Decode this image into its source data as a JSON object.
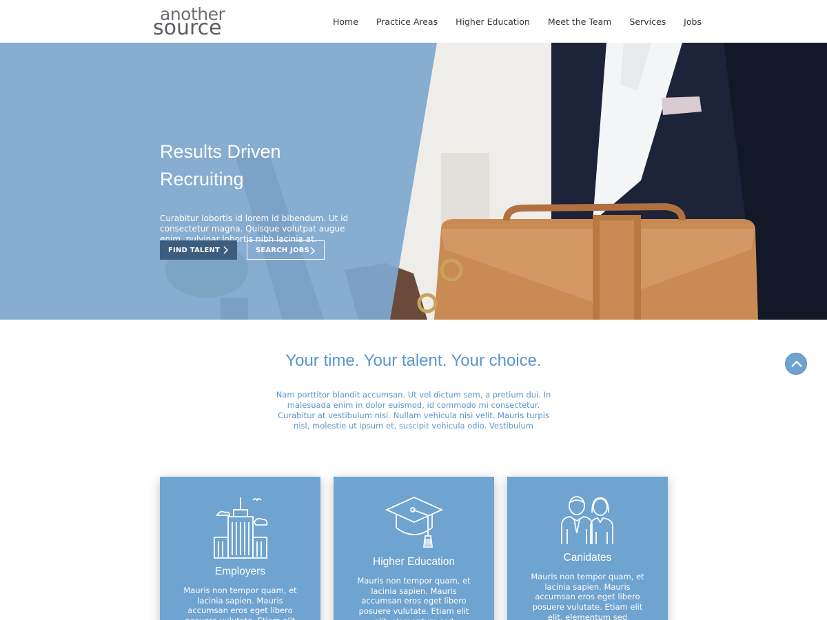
{
  "brand": {
    "logo_top": "another",
    "logo_bottom": "source"
  },
  "nav": {
    "items": [
      "Home",
      "Practice Areas",
      "Higher Education",
      "Meet the Team",
      "Services",
      "Jobs"
    ]
  },
  "hero": {
    "title_line1": "Results Driven",
    "title_line2": "Recruiting",
    "text": "Curabitur lobortis id lorem id bibendum. Ut id consectetur magna. Quisque volutpat augue enim, pulvinar lobortis nibh lacinia at.",
    "button_find_talent": "FIND TALENT",
    "button_search_jobs": "SEARCH JOBS"
  },
  "intro": {
    "title": "Your time. Your talent. Your choice.",
    "text": "Nam porttitor blandit accumsan. Ut vel dictum sem, a pretium dui. In malesuada enim in dolor euismod, id commodo mi consectetur. Curabitur at vestibulum nisi. Nullam vehicula nisi velit. Mauris turpis nisl, molestie ut ipsum et, suscipit vehicula odio. Vestibulum"
  },
  "cards": [
    {
      "title": "Employers",
      "text": "Mauris non tempor quam, et lacinia sapien. Mauris accumsan eros eget libero posuere vulutate. Etiam elit elit,",
      "icon": "city-buildings-icon"
    },
    {
      "title": "Higher Education",
      "text": "Mauris non tempor quam, et lacinia sapien. Mauris accumsan eros eget libero posuere vulutate. Etiam elit elit, elementum sed",
      "icon": "graduation-cap-icon"
    },
    {
      "title": "Canidates",
      "text": "Mauris non tempor quam, et lacinia sapien. Mauris accumsan eros eget libero posuere vulutate. Etiam elit elit, elementum sed",
      "icon": "people-icon"
    }
  ],
  "colors": {
    "accent": "#6fa3d0",
    "hero_overlay": "#7fa8cf",
    "button_dark": "#3d5d7f",
    "intro_text": "#5b96cc"
  }
}
